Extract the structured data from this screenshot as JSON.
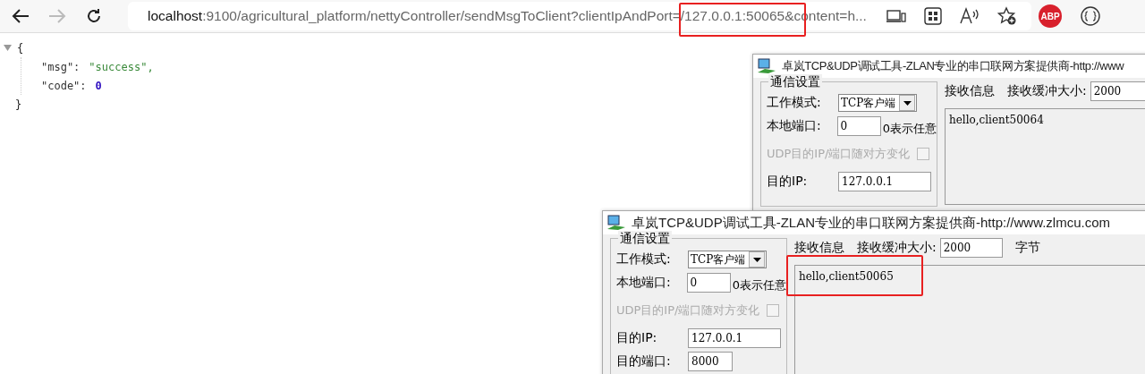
{
  "browser": {
    "back": {
      "disabled": false
    },
    "forward": {
      "disabled": true
    },
    "url_host": "localhost",
    "url_path": ":9100/agricultural_platform/nettyController/sendMsgToClient?clientIpAndPort=/127.0.0.1:50065&content=h...",
    "adblock_badge": "ABP"
  },
  "json_view": {
    "open_brace": "{",
    "close_brace": "}",
    "entries": [
      {
        "key": "\"msg\":",
        "value": "\"success\"",
        "kind": "string",
        "comma": ","
      },
      {
        "key": "\"code\":",
        "value": "0",
        "kind": "number"
      }
    ]
  },
  "windows": [
    {
      "title": "卓岚TCP&UDP调试工具-ZLAN专业的串口联网方案提供商-http://www",
      "group_title": "通信设置",
      "mode_label": "工作模式:",
      "mode_value": "TCP客户端",
      "port_label": "本地端口:",
      "port_value": "0",
      "port_hint": "0表示任意",
      "udp_label": "UDP目的IP/端口随对方变化",
      "udp_checked": false,
      "ip_label": "目的IP:",
      "ip_value": "127.0.0.1",
      "receive_label": "接收信息",
      "buffer_label": "接收缓冲大小:",
      "buffer_value": "2000",
      "received": "hello,client50064"
    },
    {
      "title": "卓岚TCP&UDP调试工具-ZLAN专业的串口联网方案提供商-http://www.zlmcu.com",
      "group_title": "通信设置",
      "mode_label": "工作模式:",
      "mode_value": "TCP客户端",
      "port_label": "本地端口:",
      "port_value": "0",
      "port_hint": "0表示任意",
      "udp_label": "UDP目的IP/端口随对方变化",
      "udp_checked": false,
      "ip_label": "目的IP:",
      "ip_value": "127.0.0.1",
      "dest_port_label": "目的端口:",
      "dest_port_value": "8000",
      "receive_label": "接收信息",
      "buffer_label": "接收缓冲大小:",
      "buffer_value": "2000",
      "buffer_unit": "字节",
      "received": "hello,client50065"
    }
  ]
}
